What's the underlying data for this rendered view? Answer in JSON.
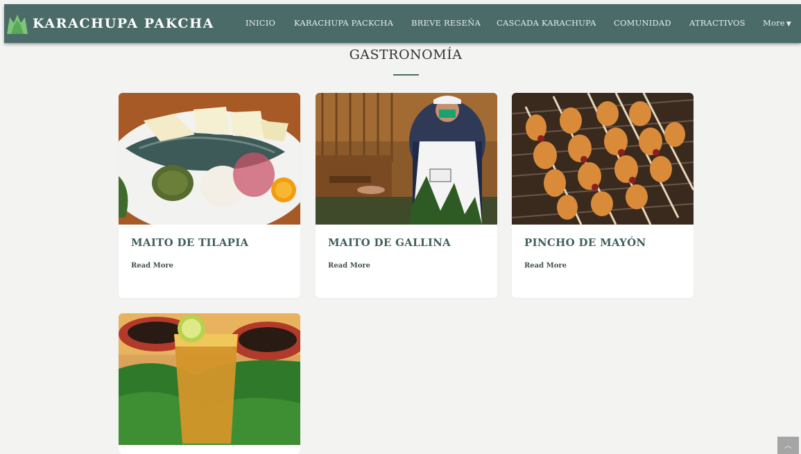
{
  "brand": {
    "title": "KARACHUPA PAKCHA",
    "logo": "mountain-logo-icon"
  },
  "nav": {
    "items": [
      "INICIO",
      "KARACHUPA PACKCHA",
      "BREVE RESEÑA",
      "CASCADA KARACHUPA",
      "COMUNIDAD",
      "ATRACTIVOS"
    ],
    "more_label": "More",
    "more_icon": "caret-down-icon"
  },
  "section": {
    "title": "GASTRONOMÍA"
  },
  "cards": [
    {
      "title": "MAITO DE TILAPIA",
      "link": "Read More",
      "image": "fish-plate-photo"
    },
    {
      "title": "MAITO DE GALLINA",
      "link": "Read More",
      "image": "cook-photo"
    },
    {
      "title": "PINCHO DE MAYÓN",
      "link": "Read More",
      "image": "grilled-larvae-skewers-photo"
    },
    {
      "title": "",
      "link": "",
      "image": "juice-glass-photo"
    }
  ],
  "scroll_top_icon": "chevron-up-icon",
  "colors": {
    "nav_bg": "#4a6b68",
    "accent": "#3f5f5b",
    "page_bg": "#f3f3f2"
  }
}
